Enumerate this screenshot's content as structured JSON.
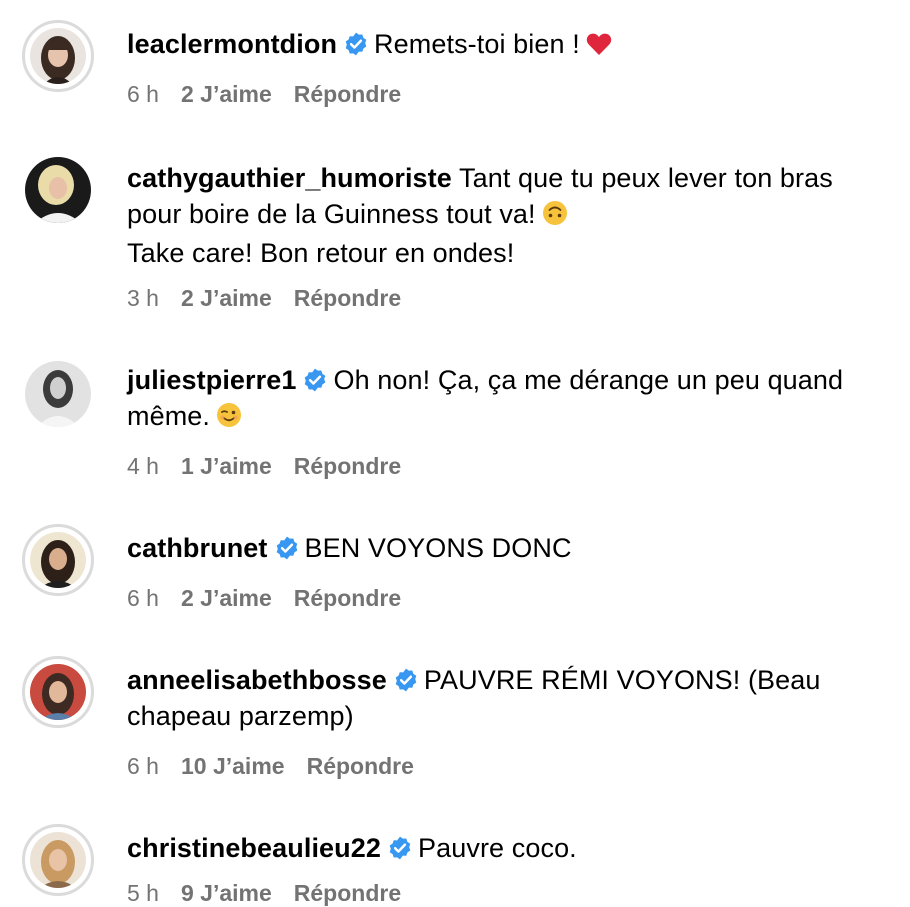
{
  "colors": {
    "verified": "#3897f0",
    "meta": "#737373",
    "heart": "#e0263c"
  },
  "comments": [
    {
      "username": "leaclermontdion",
      "verified": true,
      "text": "Remets-toi bien !",
      "emoji": "red-heart",
      "time": "6 h",
      "likes": "2 J’aime",
      "reply": "Répondre",
      "story_ring": true
    },
    {
      "username": "cathygauthier_humoriste",
      "verified": false,
      "text": "Tant que tu peux lever ton bras pour boire de la Guinness tout va!",
      "emoji": "upside-down-face",
      "text2": "Take care! Bon retour en ondes!",
      "time": "3 h",
      "likes": "2 J’aime",
      "reply": "Répondre",
      "story_ring": false
    },
    {
      "username": "juliestpierre1",
      "verified": true,
      "text": "Oh non! Ça, ça me dérange un peu quand même.",
      "emoji": "winking-face",
      "time": "4 h",
      "likes": "1 J’aime",
      "reply": "Répondre",
      "story_ring": false
    },
    {
      "username": "cathbrunet",
      "verified": true,
      "text": "BEN VOYONS DONC",
      "time": "6 h",
      "likes": "2 J’aime",
      "reply": "Répondre",
      "story_ring": true
    },
    {
      "username": "anneelisabethbosse",
      "verified": true,
      "text": "PAUVRE RÉMI VOYONS! (Beau chapeau parzemp)",
      "time": "6 h",
      "likes": "10 J’aime",
      "reply": "Répondre",
      "story_ring": true
    },
    {
      "username": "christinebeaulieu22",
      "verified": true,
      "text": "Pauvre coco.",
      "time": "5 h",
      "likes": "9 J’aime",
      "reply": "Répondre",
      "story_ring": true
    }
  ]
}
